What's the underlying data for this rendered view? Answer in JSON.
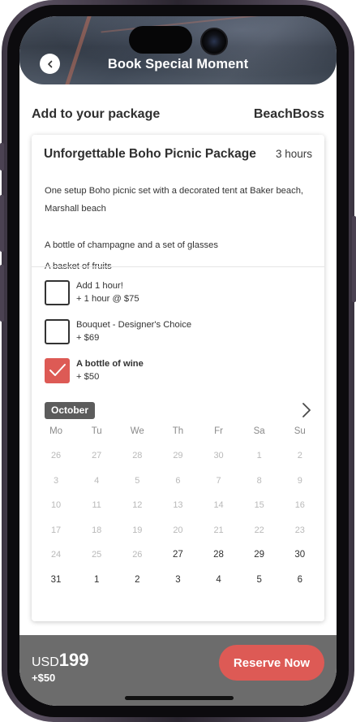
{
  "header": {
    "title": "Book Special Moment",
    "back_icon": "chevron-left-icon"
  },
  "section": {
    "title": "Add to your package",
    "brand": "BeachBoss"
  },
  "package": {
    "name": "Unforgettable Boho Picnic Package",
    "duration": "3 hours",
    "description": [
      "One setup Boho picnic set with a decorated tent  at Baker beach, Marshall beach",
      "A bottle of champagne and a set of glasses",
      "A basket of fruits"
    ]
  },
  "addons": [
    {
      "label": "Add 1 hour!",
      "price": "+ 1 hour @ $75",
      "checked": false
    },
    {
      "label": "Bouquet - Designer's Choice",
      "price": "+ $69",
      "checked": false
    },
    {
      "label": "A bottle of wine",
      "price": "+ $50",
      "checked": true
    }
  ],
  "calendar": {
    "month": "October",
    "next_icon": "chevron-right-icon",
    "weekdays": [
      "Mo",
      "Tu",
      "We",
      "Th",
      "Fr",
      "Sa",
      "Su"
    ],
    "weeks": [
      [
        "26",
        "27",
        "28",
        "29",
        "30",
        "1",
        "2"
      ],
      [
        "3",
        "4",
        "5",
        "6",
        "7",
        "8",
        "9"
      ],
      [
        "10",
        "11",
        "12",
        "13",
        "14",
        "15",
        "16"
      ],
      [
        "17",
        "18",
        "19",
        "20",
        "21",
        "22",
        "23"
      ],
      [
        "24",
        "25",
        "26",
        "27",
        "28",
        "29",
        "30"
      ],
      [
        "31",
        "1",
        "2",
        "3",
        "4",
        "5",
        "6"
      ]
    ],
    "available": [
      [
        false,
        false,
        false,
        false,
        false,
        false,
        false
      ],
      [
        false,
        false,
        false,
        false,
        false,
        false,
        false
      ],
      [
        false,
        false,
        false,
        false,
        false,
        false,
        false
      ],
      [
        false,
        false,
        false,
        false,
        false,
        false,
        false
      ],
      [
        false,
        false,
        false,
        true,
        true,
        true,
        true
      ],
      [
        true,
        true,
        true,
        true,
        true,
        true,
        true
      ]
    ]
  },
  "footer": {
    "currency": "USD",
    "amount": "199",
    "extra": "+$50",
    "reserve_label": "Reserve Now"
  },
  "colors": {
    "accent": "#dd5a55",
    "bar": "#6c6c6c",
    "text": "#2f2f2f"
  }
}
